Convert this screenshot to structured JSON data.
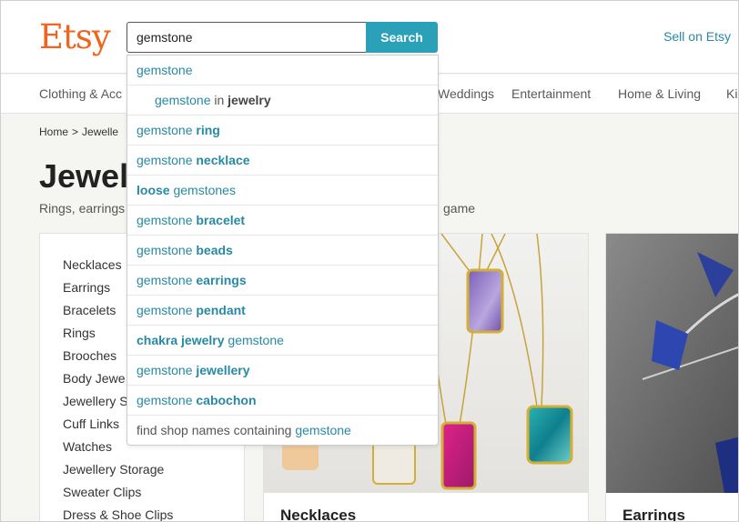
{
  "brand": {
    "logo": "Etsy",
    "color": "#f1641e",
    "accent": "#2aa1b9"
  },
  "header": {
    "search_value": "gemstone",
    "search_button": "Search",
    "sell_link": "Sell on Etsy"
  },
  "nav": {
    "items": [
      "Clothing & Acc",
      "Weddings",
      "Entertainment",
      "Home & Living",
      "Ki"
    ]
  },
  "breadcrumb": {
    "home": "Home",
    "separator": ">",
    "current": "Jewelle"
  },
  "page": {
    "title": "Jewel",
    "subtitle_start": "Rings, earrings",
    "subtitle_end": "game"
  },
  "sidebar": {
    "items": [
      "Necklaces",
      "Earrings",
      "Bracelets",
      "Rings",
      "Brooches",
      "Body Jewe",
      "Jewellery S",
      "Cuff Links",
      "Watches",
      "Jewellery Storage",
      "Sweater Clips",
      "Dress & Shoe Clips"
    ]
  },
  "cards": [
    {
      "label": "Necklaces"
    },
    {
      "label": "Earrings"
    }
  ],
  "suggestions": [
    {
      "pre": "gemstone",
      "bold": "",
      "post": ""
    },
    {
      "pre": "gemstone",
      "mid": " in ",
      "cat": "jewelry"
    },
    {
      "pre": "gemstone ",
      "bold": "ring",
      "post": ""
    },
    {
      "pre": "gemstone ",
      "bold": "necklace",
      "post": ""
    },
    {
      "pre": "",
      "bold": "loose",
      "post": " gemstones"
    },
    {
      "pre": "gemstone ",
      "bold": "bracelet",
      "post": ""
    },
    {
      "pre": "gemstone ",
      "bold": "beads",
      "post": ""
    },
    {
      "pre": "gemstone ",
      "bold": "earrings",
      "post": ""
    },
    {
      "pre": "gemstone ",
      "bold": "pendant",
      "post": ""
    },
    {
      "pre": "",
      "bold": "chakra jewelry",
      "post": " gemstone"
    },
    {
      "pre": "gemstone ",
      "bold": "jewellery",
      "post": ""
    },
    {
      "pre": "gemstone ",
      "bold": "cabochon",
      "post": ""
    },
    {
      "shop_prefix": "find shop names containing ",
      "shop_query": "gemstone"
    }
  ]
}
